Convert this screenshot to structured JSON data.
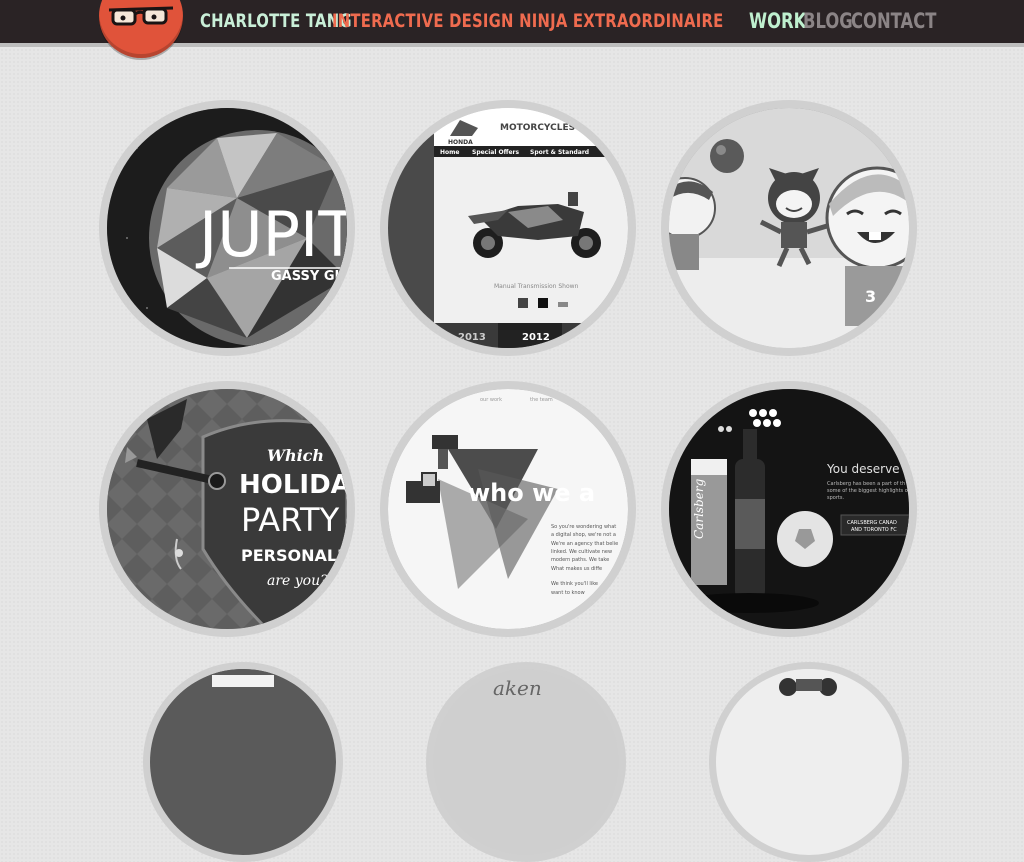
{
  "header": {
    "name": "CHARLOTTE TANG",
    "tagline": "INTERACTIVE DESIGN NINJA EXTRAORDINAIRE",
    "logo_icon": "nerd-glasses-icon",
    "nav": [
      {
        "label": "WORK",
        "active": true
      },
      {
        "label": "BLOG",
        "active": false
      },
      {
        "label": "CONTACT",
        "active": false
      }
    ]
  },
  "portfolio": [
    {
      "id": "jupiter",
      "title_text": "JUPIT",
      "subtitle_text": "GASSY GIANTS"
    },
    {
      "id": "honda",
      "brand_text": "HONDA",
      "section_text": "MOTORCYCLES",
      "menu": [
        "Home",
        "Special Offers",
        "Sport & Standard"
      ],
      "caption_text": "Manual Transmission Shown",
      "years": [
        "2013",
        "2012"
      ]
    },
    {
      "id": "characters"
    },
    {
      "id": "holiday",
      "line1": "Which",
      "line2": "HOLIDAY",
      "line3": "PARTY",
      "line4": "PERSONALITY",
      "line5": "are you?"
    },
    {
      "id": "agency",
      "nav": [
        "our work",
        "the team"
      ],
      "headline": "who we a",
      "body_lines": [
        "So you're wondering what",
        "a digital shop, we're not a",
        "We're an agency that belie",
        "linked. We cultivate new",
        "modern paths. We take",
        "What makes us diffe",
        "We think you'll like",
        "want to know"
      ]
    },
    {
      "id": "carlsberg",
      "headline": "You deserve",
      "body_lines": [
        "Carlsberg has been a part of th",
        "some of the biggest highlights o",
        "sports."
      ],
      "button_text": "CARLSBERG CANAD",
      "button_text2": "AND TORONTO FC",
      "label_text": "Carlsberg"
    }
  ],
  "partial_row": {
    "text_2": "aken"
  },
  "colors": {
    "header_bg": "#2a2325",
    "logo": "#e0533a",
    "name": "#c9efd8",
    "tagline": "#ef6b4f",
    "nav_active": "#bff0cf",
    "nav_inactive": "#8b8486"
  }
}
